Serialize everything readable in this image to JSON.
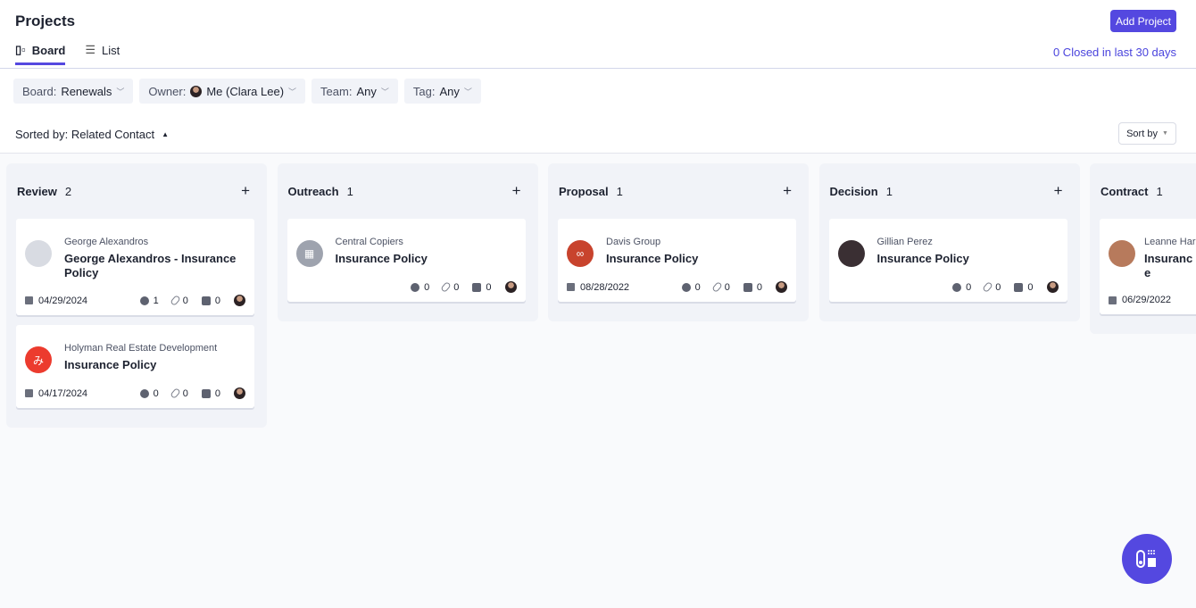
{
  "header": {
    "title": "Projects",
    "add_button": "Add Project",
    "closed_link": "0 Closed in last 30 days"
  },
  "tabs": [
    {
      "label": "Board",
      "icon": "board-icon",
      "active": true
    },
    {
      "label": "List",
      "icon": "list-icon",
      "active": false
    }
  ],
  "filters": [
    {
      "label": "Board:",
      "value": "Renewals"
    },
    {
      "label": "Owner:",
      "value": "Me (Clara Lee)",
      "avatar": true
    },
    {
      "label": "Team:",
      "value": "Any"
    },
    {
      "label": "Tag:",
      "value": "Any"
    }
  ],
  "sort": {
    "sorted_by": "Sorted by: Related Contact",
    "sort_button": "Sort by"
  },
  "colors": {
    "accent": "#5448e0",
    "column_bg": "#f1f3f8"
  },
  "columns": [
    {
      "name": "Review",
      "count": "2",
      "cards": [
        {
          "contact": "George Alexandros",
          "title": "George Alexandros - Insurance Policy",
          "logo": "person-photo",
          "logo_color": "#d8dbe2",
          "date": "04/29/2024",
          "tasks": "1",
          "attachments": "0",
          "notes": "0"
        },
        {
          "contact": "Holyman Real Estate Development",
          "title": "Insurance Policy",
          "logo": "み",
          "logo_color": "#ec3b2e",
          "date": "04/17/2024",
          "tasks": "0",
          "attachments": "0",
          "notes": "0"
        }
      ]
    },
    {
      "name": "Outreach",
      "count": "1",
      "cards": [
        {
          "contact": "Central Copiers",
          "title": "Insurance Policy",
          "logo": "building-icon",
          "logo_color": "#9ea3ae",
          "date": "",
          "tasks": "0",
          "attachments": "0",
          "notes": "0"
        }
      ]
    },
    {
      "name": "Proposal",
      "count": "1",
      "cards": [
        {
          "contact": "Davis Group",
          "title": "Insurance Policy",
          "logo": "∞",
          "logo_color": "#c8432d",
          "date": "08/28/2022",
          "tasks": "0",
          "attachments": "0",
          "notes": "0"
        }
      ]
    },
    {
      "name": "Decision",
      "count": "1",
      "cards": [
        {
          "contact": "Gillian Perez",
          "title": "Insurance Policy",
          "logo": "person-photo",
          "logo_color": "#3a2f33",
          "date": "",
          "tasks": "0",
          "attachments": "0",
          "notes": "0"
        }
      ]
    },
    {
      "name": "Contract",
      "count": "1",
      "cards": [
        {
          "contact": "Leanne Har",
          "title": "Insurance",
          "logo": "person-photo",
          "logo_color": "#b77a5c",
          "date": "06/29/2022",
          "tasks": "",
          "attachments": "",
          "notes": ""
        }
      ]
    }
  ]
}
